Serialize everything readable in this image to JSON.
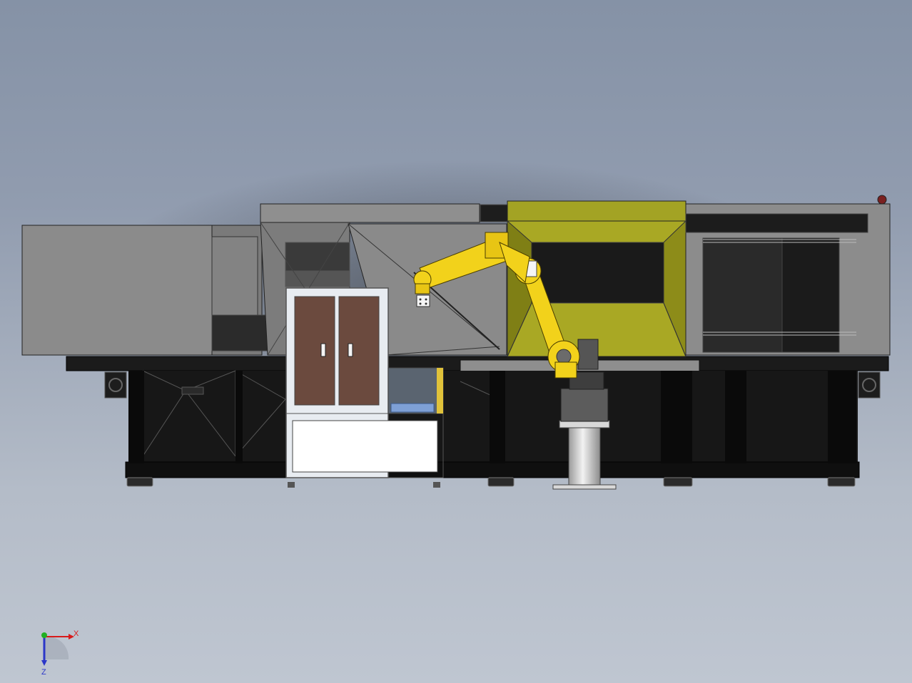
{
  "viewport": {
    "background_top": "#8592a6",
    "background_bottom": "#bfc6d1"
  },
  "scene": {
    "robot_color": "#f2d21b",
    "mold_cover_color": "#a3a324",
    "cabinet_door_color": "#6b4a3e",
    "frame_color": "#0d0d0d",
    "panel_color": "#8a8a8a"
  },
  "triad": {
    "x_label": "X",
    "z_label": "Z",
    "x_color": "#d81b1b",
    "y_color": "#22b022",
    "z_color": "#2b36c8"
  }
}
